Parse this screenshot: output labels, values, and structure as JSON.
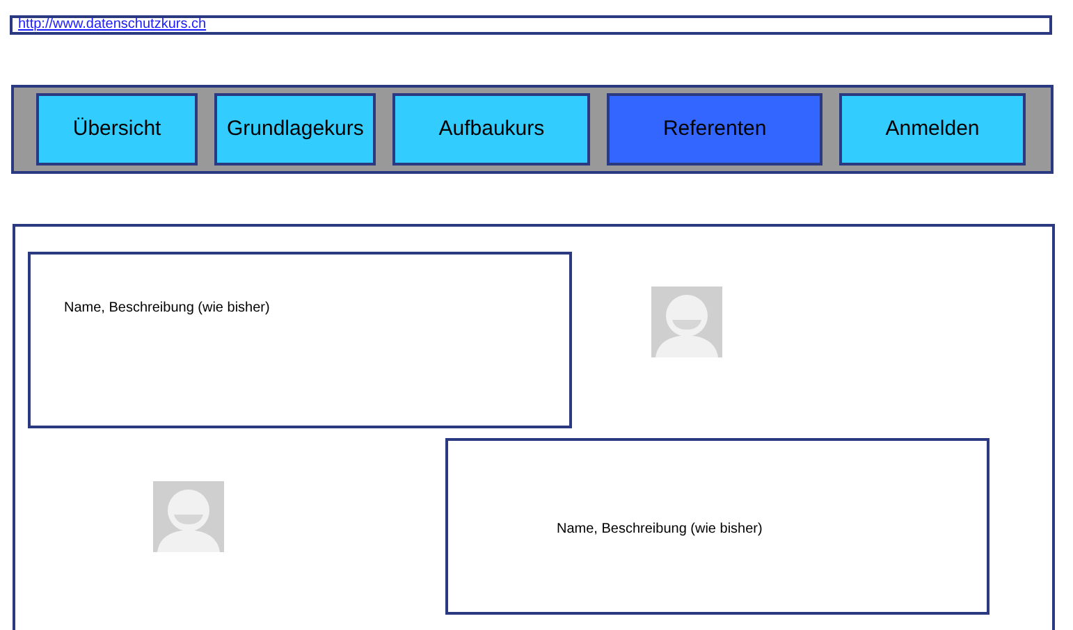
{
  "url": "http://www.datenschutzkurs.ch",
  "nav": [
    {
      "label": "Übersicht",
      "selected": false
    },
    {
      "label": "Grundlagekurs",
      "selected": false
    },
    {
      "label": "Aufbaukurs",
      "selected": false
    },
    {
      "label": "Referenten",
      "selected": true
    },
    {
      "label": "Anmelden",
      "selected": false
    }
  ],
  "referents": [
    {
      "kind": "text-left",
      "text": "Name, Beschreibung (wie bisher)"
    },
    {
      "kind": "text-right",
      "text": "Name, Beschreibung (wie bisher)"
    }
  ]
}
